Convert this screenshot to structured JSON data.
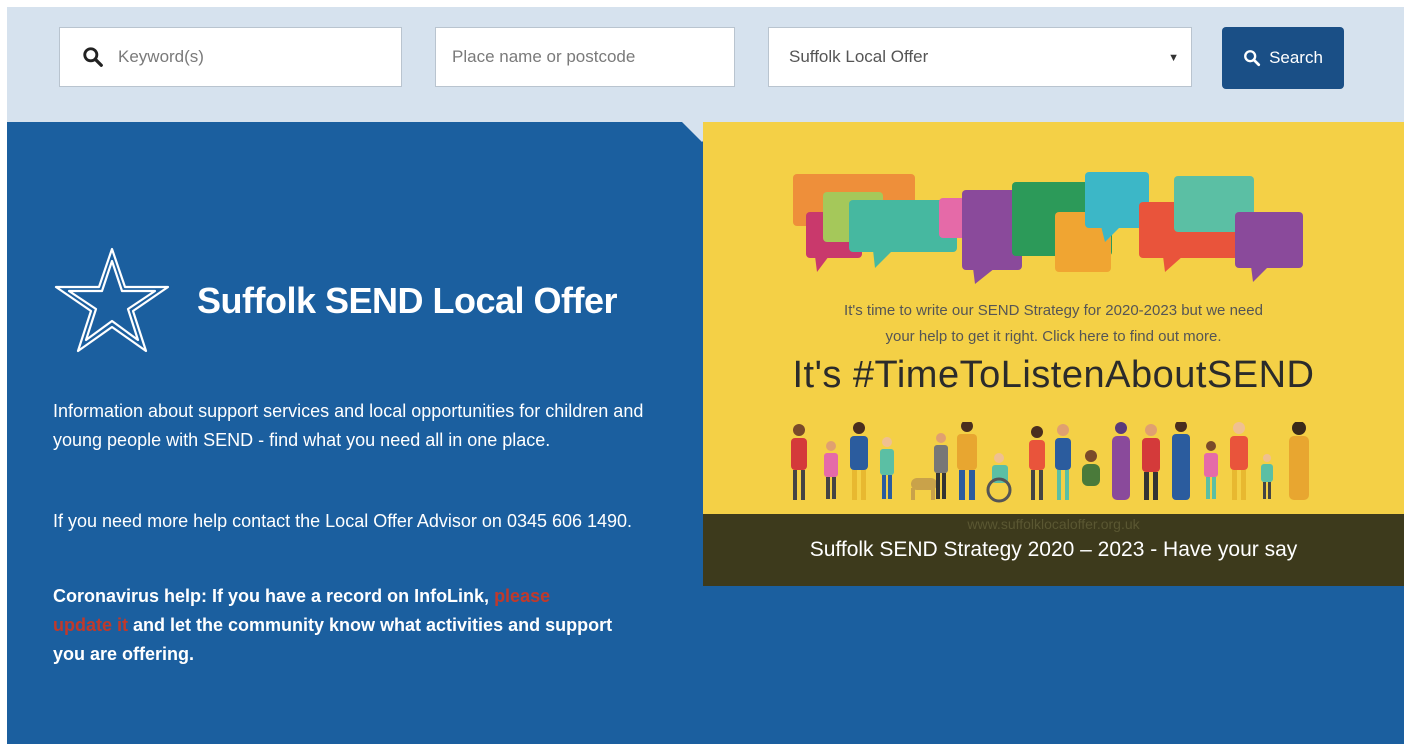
{
  "search": {
    "keyword_placeholder": "Keyword(s)",
    "place_placeholder": "Place name or postcode",
    "directory_selected": "Suffolk Local Offer",
    "button_label": "Search"
  },
  "hero": {
    "title": "Suffolk SEND Local Offer",
    "intro": "Information about support services and local opportunities for children and young people with SEND - find what you need all in one place.",
    "help": "If you need more help contact the Local Offer Advisor on 0345 606 1490.",
    "corona_prefix": "Coronavirus help: If you have a record on InfoLink, ",
    "corona_link": "please update it",
    "corona_suffix": " and let the community know what activities and support you are offering."
  },
  "banner": {
    "line1": "It's time to write our SEND Strategy for 2020-2023 but we need",
    "line2": "your help to get it right. Click here to find out more.",
    "hashtag": "It's #TimeToListenAboutSEND",
    "url": "www.suffolklocaloffer.org.uk",
    "caption": "Suffolk SEND Strategy 2020 – 2023 - Have your say"
  },
  "colors": {
    "search_band": "#d6e2ee",
    "hero_blue": "#1b5f9f",
    "button_blue": "#1a4f86",
    "banner_yellow": "#f4d046",
    "banner_footer": "#3d3a1c",
    "link_red": "#c0392b"
  },
  "icons": [
    "search-icon",
    "star-icon",
    "dropdown-caret-icon"
  ]
}
